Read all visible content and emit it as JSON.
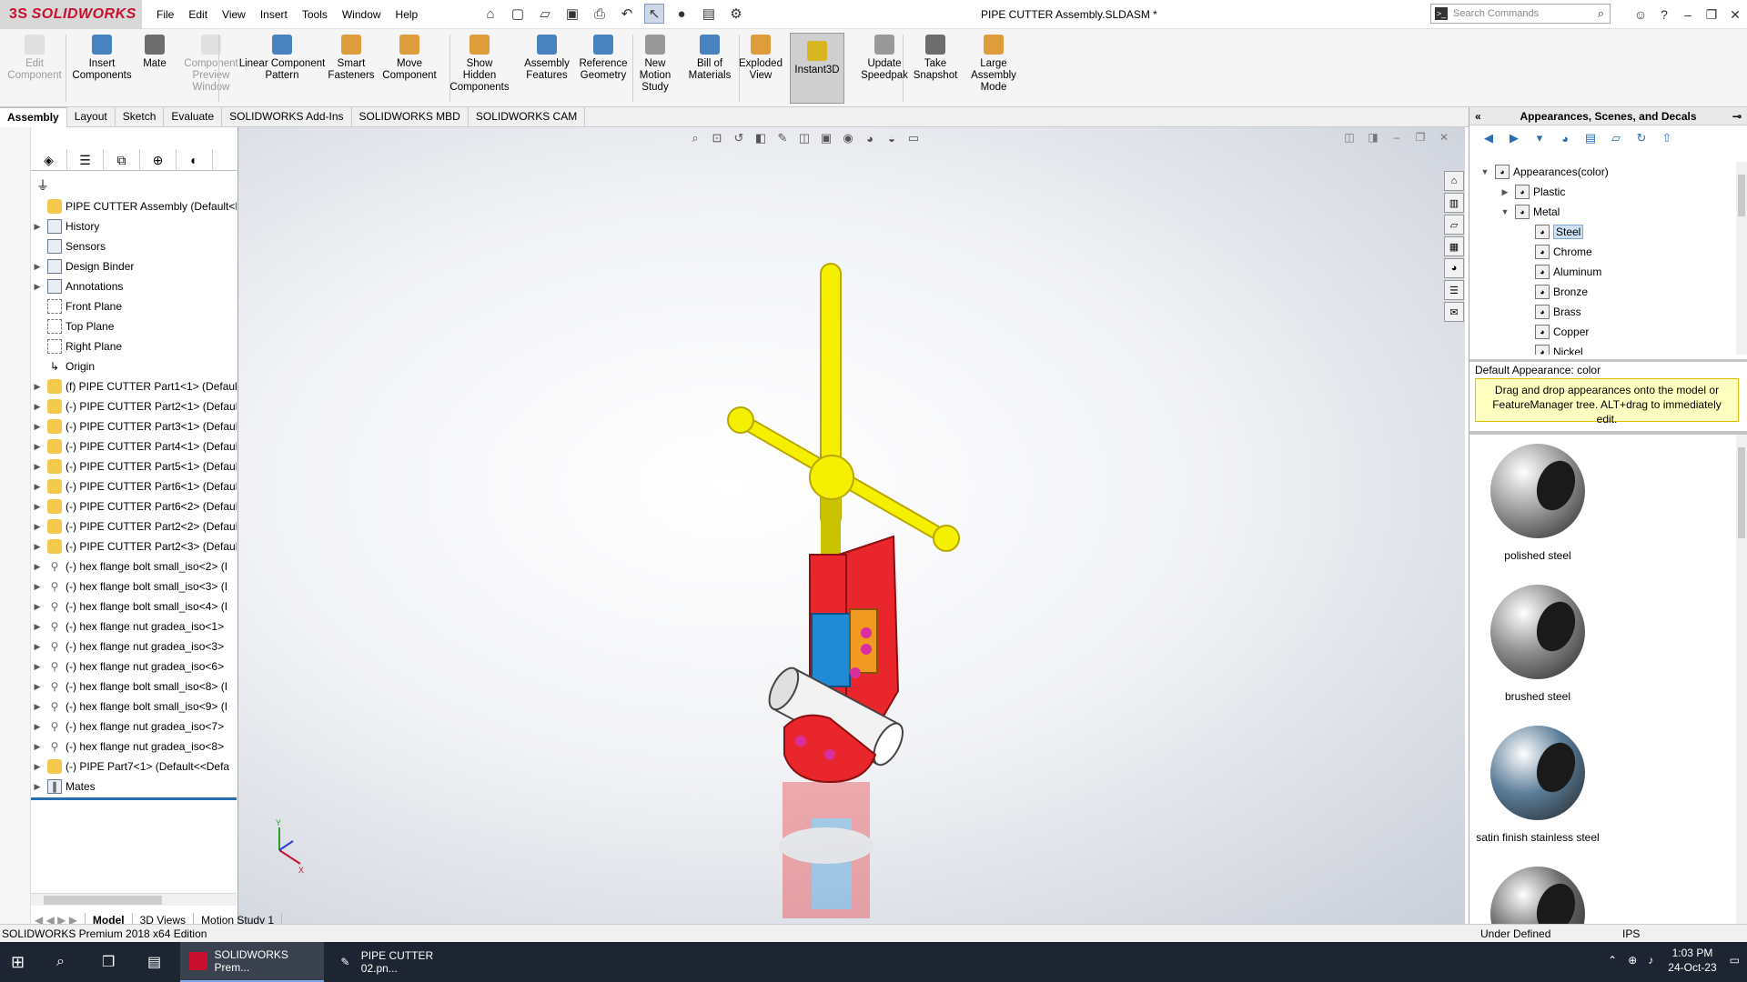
{
  "app": {
    "brand": "SOLIDWORKS",
    "brand_mark": "3S"
  },
  "menus": [
    "File",
    "Edit",
    "View",
    "Insert",
    "Tools",
    "Window",
    "Help"
  ],
  "document_title": "PIPE CUTTER Assembly.SLDASM *",
  "search_placeholder": "Search Commands",
  "ribbon": [
    {
      "label": "Edit\nComponent",
      "disabled": true
    },
    {
      "label": "Insert\nComponents"
    },
    {
      "label": "Mate"
    },
    {
      "label": "Component\nPreview\nWindow",
      "disabled": true
    },
    {
      "label": "Linear Component\nPattern"
    },
    {
      "label": "Smart\nFasteners"
    },
    {
      "label": "Move\nComponent"
    },
    {
      "label": "Show\nHidden\nComponents"
    },
    {
      "label": "Assembly\nFeatures"
    },
    {
      "label": "Reference\nGeometry"
    },
    {
      "label": "New\nMotion\nStudy"
    },
    {
      "label": "Bill of\nMaterials"
    },
    {
      "label": "Exploded\nView"
    },
    {
      "label": "Instant3D",
      "active": true
    },
    {
      "label": "Update\nSpeedpak"
    },
    {
      "label": "Take\nSnapshot"
    },
    {
      "label": "Large\nAssembly\nMode"
    }
  ],
  "tabs": [
    "Assembly",
    "Layout",
    "Sketch",
    "Evaluate",
    "SOLIDWORKS Add-Ins",
    "SOLIDWORKS MBD",
    "SOLIDWORKS CAM"
  ],
  "active_tab": "Assembly",
  "tree": {
    "root": "PIPE CUTTER Assembly  (Default<Disp",
    "items": [
      {
        "label": "History",
        "icon": "folder",
        "expand": true
      },
      {
        "label": "Sensors",
        "icon": "folder",
        "expand": false
      },
      {
        "label": "Design Binder",
        "icon": "folder",
        "expand": true
      },
      {
        "label": "Annotations",
        "icon": "folder",
        "expand": true
      },
      {
        "label": "Front Plane",
        "icon": "plane",
        "expand": false
      },
      {
        "label": "Top Plane",
        "icon": "plane",
        "expand": false
      },
      {
        "label": "Right Plane",
        "icon": "plane",
        "expand": false
      },
      {
        "label": "Origin",
        "icon": "origin",
        "expand": false
      },
      {
        "label": "(f) PIPE CUTTER Part1<1> (Default",
        "icon": "part",
        "expand": true
      },
      {
        "label": "(-) PIPE CUTTER Part2<1> (Defaul",
        "icon": "part",
        "expand": true
      },
      {
        "label": "(-) PIPE CUTTER Part3<1> (Defaul",
        "icon": "part",
        "expand": true
      },
      {
        "label": "(-) PIPE CUTTER Part4<1> (Defaul",
        "icon": "part",
        "expand": true
      },
      {
        "label": "(-) PIPE CUTTER Part5<1> (Defaul",
        "icon": "part",
        "expand": true
      },
      {
        "label": "(-) PIPE CUTTER Part6<1> (Defaul",
        "icon": "part",
        "expand": true
      },
      {
        "label": "(-) PIPE CUTTER Part6<2> (Defaul",
        "icon": "part",
        "expand": true
      },
      {
        "label": "(-) PIPE CUTTER Part2<2> (Defaul",
        "icon": "part",
        "expand": true
      },
      {
        "label": "(-) PIPE CUTTER Part2<3> (Defaul",
        "icon": "part",
        "expand": true
      },
      {
        "label": "(-) hex flange bolt small_iso<2> (I",
        "icon": "bolt",
        "expand": true
      },
      {
        "label": "(-) hex flange bolt small_iso<3> (I",
        "icon": "bolt",
        "expand": true
      },
      {
        "label": "(-) hex flange bolt small_iso<4> (I",
        "icon": "bolt",
        "expand": true
      },
      {
        "label": "(-) hex flange nut gradea_iso<1>",
        "icon": "bolt",
        "expand": true
      },
      {
        "label": "(-) hex flange nut gradea_iso<3>",
        "icon": "bolt",
        "expand": true
      },
      {
        "label": "(-) hex flange nut gradea_iso<6>",
        "icon": "bolt",
        "expand": true
      },
      {
        "label": "(-) hex flange bolt small_iso<8> (I",
        "icon": "bolt",
        "expand": true
      },
      {
        "label": "(-) hex flange bolt small_iso<9> (I",
        "icon": "bolt",
        "expand": true
      },
      {
        "label": "(-) hex flange nut gradea_iso<7>",
        "icon": "bolt",
        "expand": true
      },
      {
        "label": "(-) hex flange nut gradea_iso<8>",
        "icon": "bolt",
        "expand": true
      },
      {
        "label": "(-) PIPE Part7<1> (Default<<Defa",
        "icon": "part",
        "expand": true
      },
      {
        "label": "Mates",
        "icon": "mates",
        "expand": true
      }
    ]
  },
  "bottom_tabs": [
    "Model",
    "3D Views",
    "Motion Study 1"
  ],
  "active_bottom_tab": "Model",
  "task_pane": {
    "title": "Appearances, Scenes, and Decals",
    "tree": [
      {
        "label": "Appearances(color)",
        "level": 0,
        "expand": "open"
      },
      {
        "label": "Plastic",
        "level": 1,
        "expand": "closed"
      },
      {
        "label": "Metal",
        "level": 1,
        "expand": "open"
      },
      {
        "label": "Steel",
        "level": 2,
        "selected": true
      },
      {
        "label": "Chrome",
        "level": 2
      },
      {
        "label": "Aluminum",
        "level": 2
      },
      {
        "label": "Bronze",
        "level": 2
      },
      {
        "label": "Brass",
        "level": 2
      },
      {
        "label": "Copper",
        "level": 2
      },
      {
        "label": "Nickel",
        "level": 2
      }
    ],
    "default_appearance": "Default Appearance: color",
    "tip": "Drag and drop appearances onto the model or FeatureManager tree.  ALT+drag to immediately edit.",
    "swatches": [
      {
        "label": "polished steel",
        "color": "#9a9a9a"
      },
      {
        "label": "brushed steel",
        "color": "#8c8c8c"
      },
      {
        "label": "satin finish stainless steel",
        "color": "#5b7d99"
      },
      {
        "label": "",
        "color": "#6d6d6d"
      }
    ]
  },
  "status": {
    "left": "SOLIDWORKS Premium 2018 x64 Edition",
    "mid": "Under Defined",
    "units": "IPS"
  },
  "taskbar": {
    "items": [
      {
        "label": "SOLIDWORKS Prem..."
      },
      {
        "label": "PIPE CUTTER 02.pn..."
      }
    ],
    "time": "1:03 PM",
    "date": "24-Oct-23"
  },
  "colors": {
    "brand": "#c8102e",
    "model_yellow": "#f5ef00",
    "model_red": "#e8262b",
    "model_blue": "#1f8ad6",
    "accent": "#2a6fb5"
  }
}
